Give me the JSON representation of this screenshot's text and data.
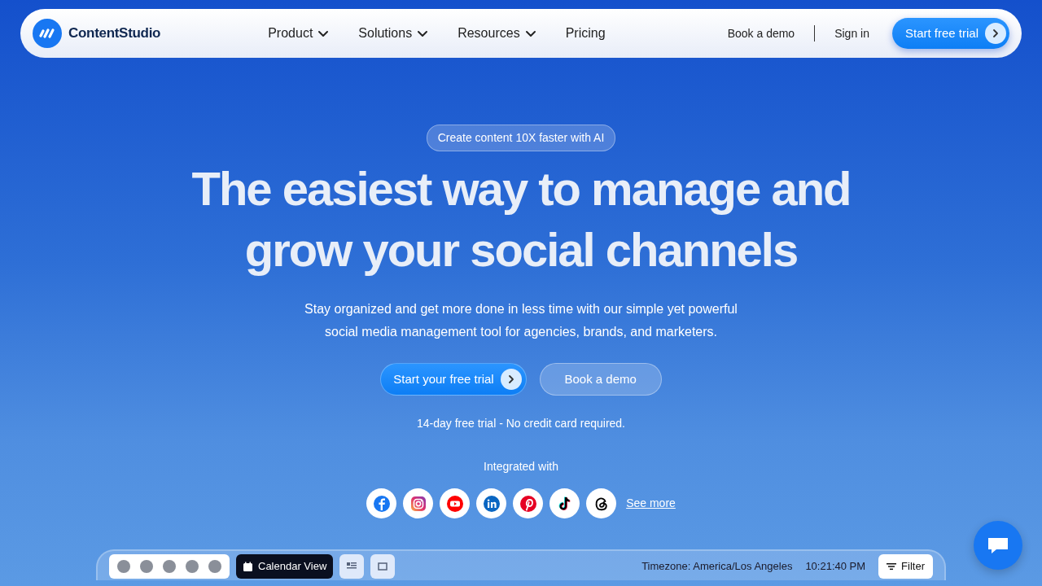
{
  "nav": {
    "logo": "ContentStudio",
    "menu": [
      {
        "label": "Product",
        "dropdown": true
      },
      {
        "label": "Solutions",
        "dropdown": true
      },
      {
        "label": "Resources",
        "dropdown": true
      },
      {
        "label": "Pricing",
        "dropdown": false
      }
    ],
    "book_demo": "Book a demo",
    "sign_in": "Sign in",
    "cta": "Start free trial"
  },
  "hero": {
    "badge": "Create content 10X faster with AI",
    "headline": [
      "The easiest way to manage and",
      "grow your social channels"
    ],
    "subtitle": "Stay organized and get more done in less time with our simple yet powerful social media management tool for agencies, brands, and marketers.",
    "primary_button": "Start your free trial",
    "secondary_button": "Book a demo",
    "note": "14-day free trial - No credit card required.",
    "integrations_label": "Integrated with",
    "integrations": [
      {
        "kind": "facebook"
      },
      {
        "kind": "instagram"
      },
      {
        "kind": "youtube"
      },
      {
        "kind": "linkedin"
      },
      {
        "kind": "pinterest"
      },
      {
        "kind": "tiktok"
      },
      {
        "kind": "threads"
      }
    ],
    "see_more": "See more"
  },
  "preview": {
    "view_button": "Calendar View",
    "timezone": "Timezone: America/Los Angeles",
    "time": "10:21:40 PM",
    "filter": "Filter"
  }
}
